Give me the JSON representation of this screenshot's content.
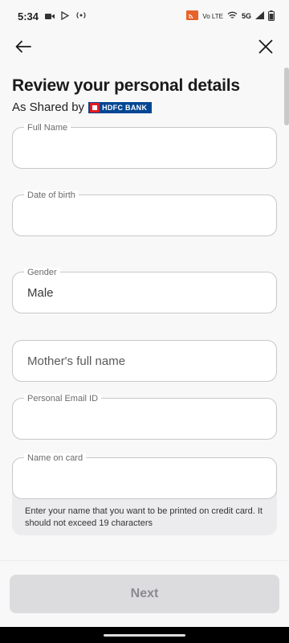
{
  "status": {
    "time": "5:34",
    "network": "5G",
    "vo_lte": "Vo LTE"
  },
  "title": "Review your personal details",
  "subtitle": "As Shared by",
  "bank_name": "HDFC BANK",
  "fields": {
    "full_name": {
      "label": "Full Name",
      "value": ""
    },
    "dob": {
      "label": "Date of birth",
      "value": ""
    },
    "gender": {
      "label": "Gender",
      "value": "Male"
    },
    "mother": {
      "placeholder": "Mother's full name"
    },
    "email": {
      "label": "Personal Email ID",
      "value": ""
    },
    "name_on_card": {
      "label": "Name on card",
      "value": ""
    }
  },
  "hint": "Enter your name that you want to be printed on credit card. It should not exceed 19 characters",
  "next_label": "Next",
  "colors": {
    "accent_bank": "#034694",
    "bank_red": "#e31b23",
    "button_disabled": "#dcdcde"
  }
}
